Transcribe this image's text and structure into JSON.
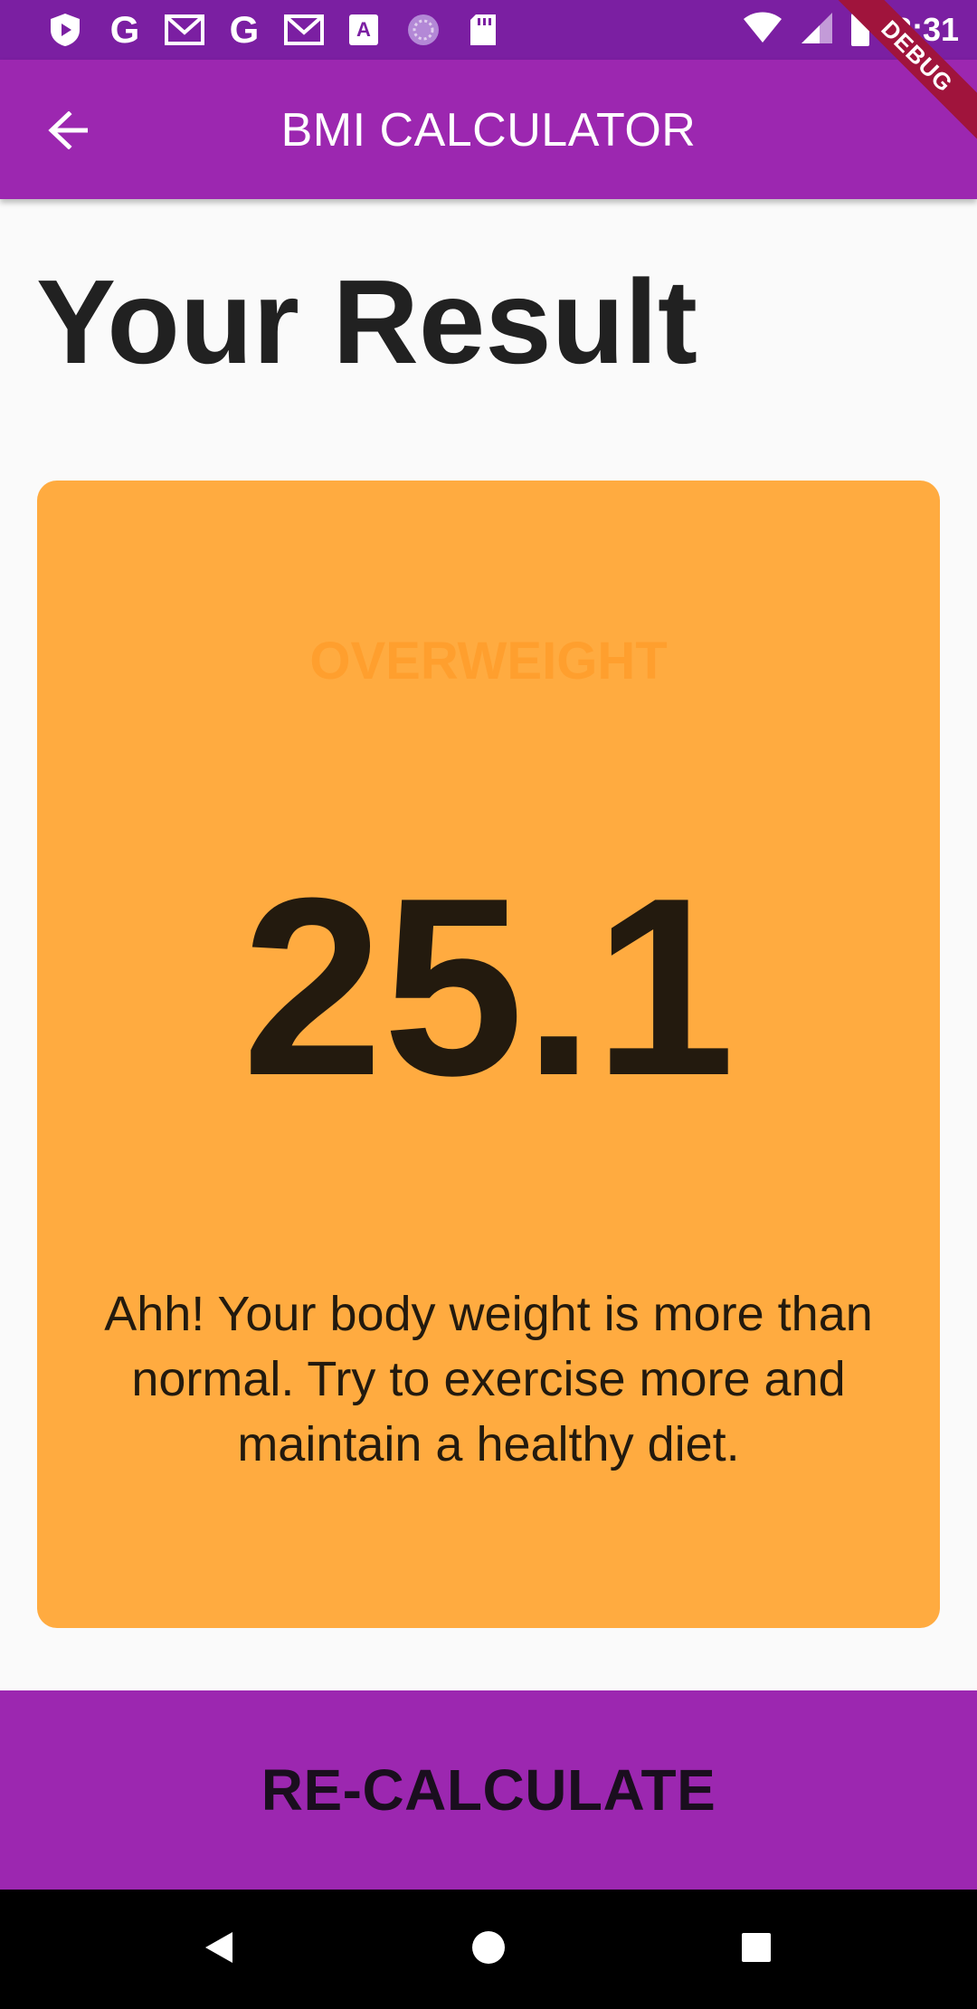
{
  "status_bar": {
    "time": "3:31",
    "left_icons": [
      "shield-icon",
      "google-icon",
      "gmail-icon",
      "google-icon",
      "gmail-icon",
      "text-icon",
      "sync-icon",
      "sd-card-icon"
    ],
    "right_icons": [
      "wifi-icon",
      "cell-signal-icon",
      "battery-icon"
    ],
    "text_icon_letter": "A",
    "google_letter": "G"
  },
  "debug_banner": {
    "label": "DEBUG"
  },
  "app_bar": {
    "title": "BMI CALCULATOR",
    "back_icon": "arrow-back-icon"
  },
  "main": {
    "title": "Your Result",
    "card": {
      "status": "OVERWEIGHT",
      "bmi_value": "25.1",
      "message": "Ahh! Your body weight is more than normal. Try to exercise more and maintain a healthy diet.",
      "background_color": "#ffab40"
    },
    "button_label": "RE-CALCULATE"
  },
  "colors": {
    "accent": "#9c27b0",
    "status_bar": "#7b1fa2",
    "card": "#ffab40"
  }
}
